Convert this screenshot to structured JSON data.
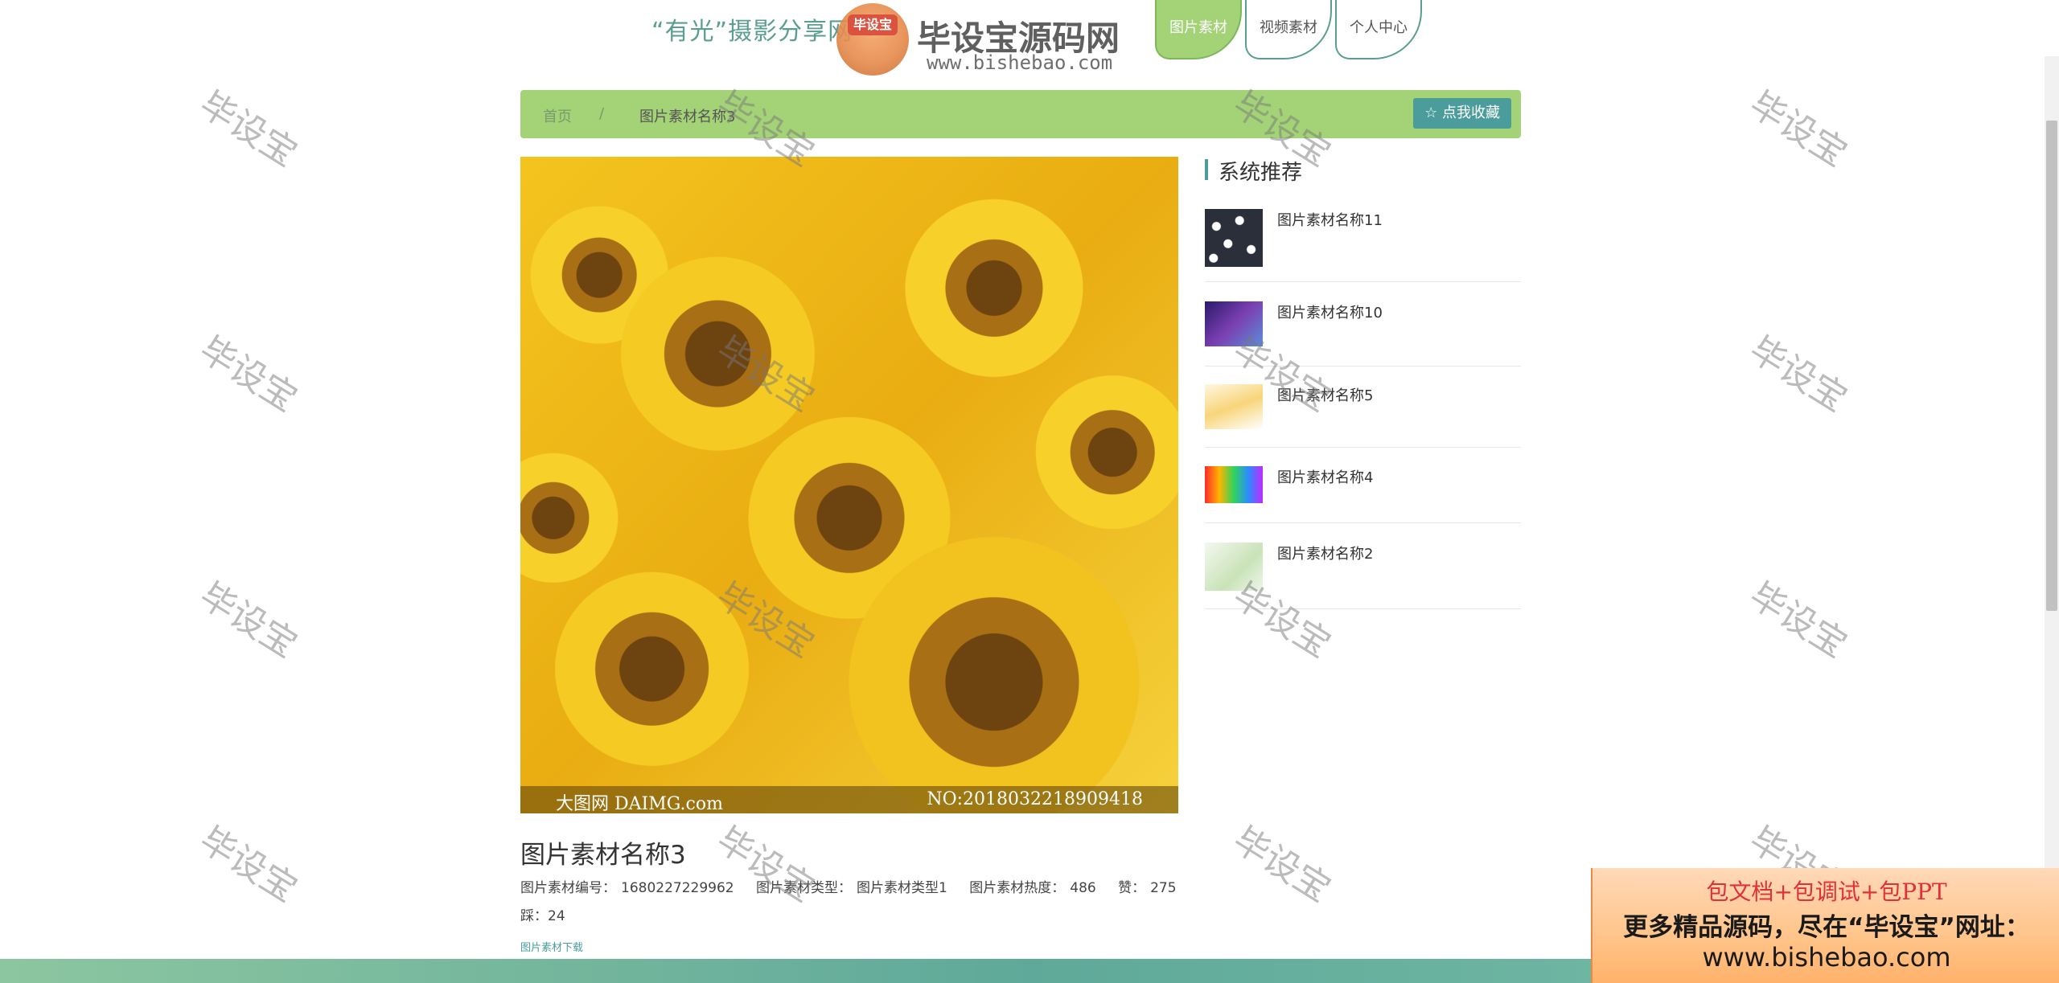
{
  "header": {
    "site_title": "“有光”摄影分享网",
    "nav": [
      {
        "label": "图片素材",
        "active": true
      },
      {
        "label": "视频素材",
        "active": false
      },
      {
        "label": "个人中心",
        "active": false
      }
    ]
  },
  "watermark": {
    "badge": "毕设宝",
    "name": "毕设宝源码网",
    "url": "www.bishebao.com",
    "tile": "毕设宝"
  },
  "breadcrumb": {
    "home": "首页",
    "separator": "/",
    "current": "图片素材名称3",
    "favorite_button": "☆ 点我收藏"
  },
  "image": {
    "caption_left": "大图网 DAIMG.com",
    "caption_right": "NO:2018032218909418"
  },
  "detail": {
    "title": "图片素材名称3",
    "code_label": "图片素材编号：",
    "code_value": "1680227229962",
    "type_label": "图片素材类型：",
    "type_value": "图片素材类型1",
    "heat_label": "图片素材热度：",
    "heat_value": "486",
    "like_label": "赞：",
    "like_value": "275",
    "dislike_label": "踩：",
    "dislike_value": "24",
    "download_link": "图片素材下载"
  },
  "sidebar": {
    "title": "系统推荐",
    "items": [
      {
        "label": "图片素材名称11"
      },
      {
        "label": "图片素材名称10"
      },
      {
        "label": "图片素材名称5"
      },
      {
        "label": "图片素材名称4"
      },
      {
        "label": "图片素材名称2"
      }
    ]
  },
  "ad": {
    "line1": "包文档+包调试+包PPT",
    "line2": "更多精品源码，尽在“毕设宝”网址：",
    "line3": "www.bishebao.com"
  },
  "colors": {
    "accent_green": "#a3d277",
    "accent_teal": "#4a9d9b",
    "title_teal": "#5a9e8f"
  }
}
